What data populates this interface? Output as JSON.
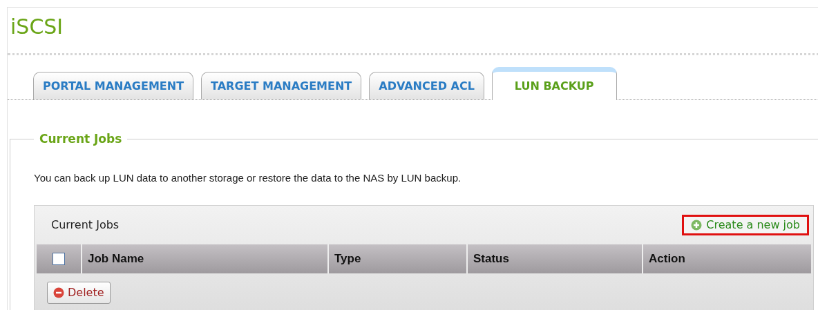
{
  "title": "iSCSI",
  "tabs": [
    {
      "label": "PORTAL MANAGEMENT",
      "selected": false
    },
    {
      "label": "TARGET MANAGEMENT",
      "selected": false
    },
    {
      "label": "ADVANCED ACL",
      "selected": false
    },
    {
      "label": "LUN BACKUP",
      "selected": true
    }
  ],
  "section": {
    "legend": "Current Jobs",
    "description": "You can back up LUN data to another storage or restore the data to the NAS by LUN backup."
  },
  "table": {
    "title": "Current Jobs",
    "create_button": {
      "label": "Create a new job",
      "highlighted": true
    },
    "select_all_checked": false,
    "columns": [
      "Job Name",
      "Type",
      "Status",
      "Action"
    ],
    "delete_button": "Delete"
  }
}
